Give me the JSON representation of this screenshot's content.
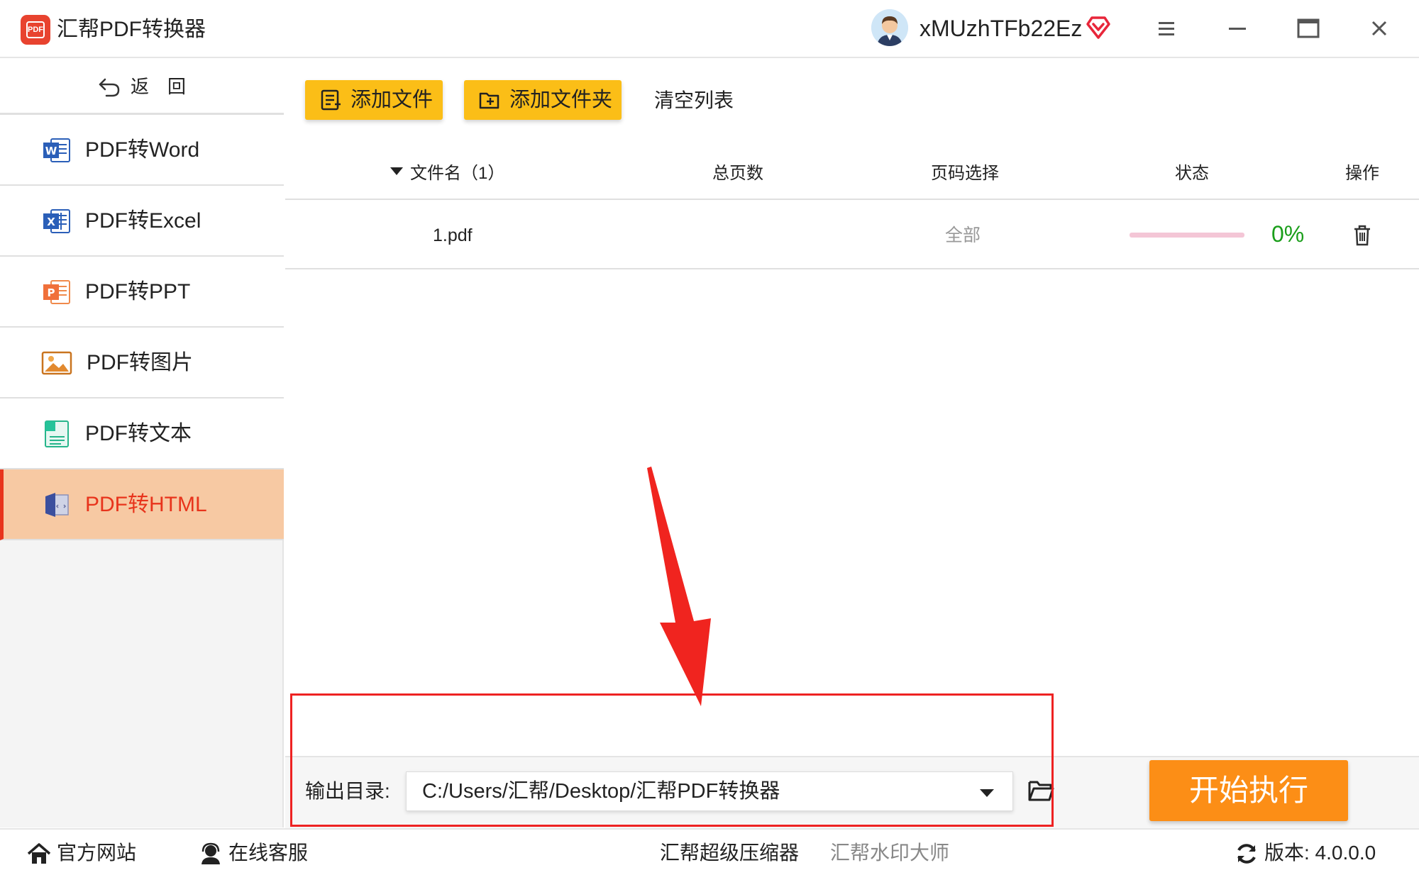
{
  "app": {
    "title": "汇帮PDF转换器",
    "logo_text": "PDF",
    "username": "xMUzhTFb22Ez"
  },
  "sidebar": {
    "back_label": "返回",
    "items": [
      {
        "label": "PDF转Word",
        "icon": "word-icon",
        "active": false
      },
      {
        "label": "PDF转Excel",
        "icon": "excel-icon",
        "active": false
      },
      {
        "label": "PDF转PPT",
        "icon": "ppt-icon",
        "active": false
      },
      {
        "label": "PDF转图片",
        "icon": "image-icon",
        "active": false
      },
      {
        "label": "PDF转文本",
        "icon": "text-icon",
        "active": false
      },
      {
        "label": "PDF转HTML",
        "icon": "html-icon",
        "active": true
      }
    ]
  },
  "toolbar": {
    "add_file": "添加文件",
    "add_folder": "添加文件夹",
    "clear_list": "清空列表"
  },
  "table": {
    "columns": {
      "filename": "文件名（1）",
      "pages": "总页数",
      "page_select": "页码选择",
      "status": "状态",
      "action": "操作"
    },
    "rows": [
      {
        "filename": "1.pdf",
        "pages": "",
        "page_select": "全部",
        "progress": 0,
        "progress_text": "0%"
      }
    ]
  },
  "output": {
    "label": "输出目录:",
    "path": "C:/Users/汇帮/Desktop/汇帮PDF转换器"
  },
  "start_button": "开始执行",
  "footer": {
    "website": "官方网站",
    "support": "在线客服",
    "compressor": "汇帮超级压缩器",
    "watermark": "汇帮水印大师",
    "version": "版本: 4.0.0.0"
  },
  "colors": {
    "accent_orange": "#fc8e16",
    "button_yellow": "#fbbe17",
    "active_nav_bg": "#f7c9a3",
    "active_nav_text": "#e8341c",
    "progress_text_green": "#1a9e1a",
    "annotation_red": "#ee2222"
  }
}
